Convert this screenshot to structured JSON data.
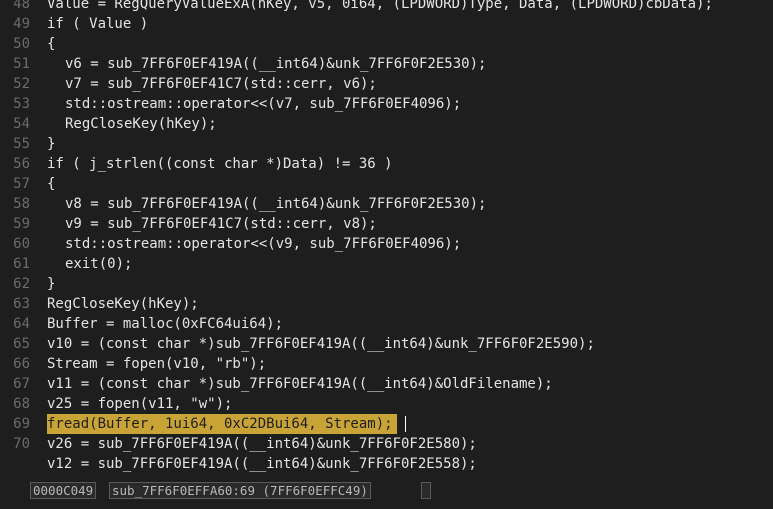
{
  "editor": {
    "lines": [
      {
        "n": "48",
        "c": "Value = RegQueryValueExA(hKey, v5, 0i64, (LPDWORD)Type, Data, (LPDWORD)cbData);"
      },
      {
        "n": "49",
        "c": "if ( Value )"
      },
      {
        "n": "50",
        "c": "{"
      },
      {
        "n": "51",
        "c": "v6 = sub_7FF6F0EF419A((__int64)&unk_7FF6F0F2E530);"
      },
      {
        "n": "52",
        "c": "v7 = sub_7FF6F0EF41C7(std::cerr, v6);"
      },
      {
        "n": "53",
        "c": "std::ostream::operator<<(v7, sub_7FF6F0EF4096);"
      },
      {
        "n": "54",
        "c": "RegCloseKey(hKey);"
      },
      {
        "n": "55",
        "c": "}"
      },
      {
        "n": "56",
        "c": "if ( j_strlen((const char *)Data) != 36 )"
      },
      {
        "n": "57",
        "c": "{"
      },
      {
        "n": "58",
        "c": "v8 = sub_7FF6F0EF419A((__int64)&unk_7FF6F0F2E530);"
      },
      {
        "n": "59",
        "c": "v9 = sub_7FF6F0EF41C7(std::cerr, v8);"
      },
      {
        "n": "60",
        "c": "std::ostream::operator<<(v9, sub_7FF6F0EF4096);"
      },
      {
        "n": "61",
        "c": "exit(0);"
      },
      {
        "n": "62",
        "c": "}"
      },
      {
        "n": "63",
        "c": "RegCloseKey(hKey);"
      },
      {
        "n": "64",
        "c": "Buffer = malloc(0xFC64ui64);"
      },
      {
        "n": "65",
        "c": "v10 = (const char *)sub_7FF6F0EF419A((__int64)&unk_7FF6F0F2E590);"
      },
      {
        "n": "66",
        "c": "Stream = fopen(v10, \"rb\");"
      },
      {
        "n": "67",
        "c": "v11 = (const char *)sub_7FF6F0EF419A((__int64)&OldFilename);"
      },
      {
        "n": "68",
        "c": "v25 = fopen(v11, \"w\");"
      },
      {
        "n": "69",
        "c": "fread(Buffer, 1ui64, 0xC2DBui64, Stream);"
      },
      {
        "n": "70",
        "c": "v26 = sub_7FF6F0EF419A((__int64)&unk_7FF6F0F2E580);"
      },
      {
        "n": "",
        "c": "v12 = sub_7FF6F0EF419A((__int64)&unk_7FF6F0F2E558);"
      }
    ],
    "highlighted_line": "69"
  },
  "statusbar": {
    "address": "0000C049",
    "location": "sub_7FF6F0EFFA60:69 (7FF6F0EFFC49)"
  }
}
